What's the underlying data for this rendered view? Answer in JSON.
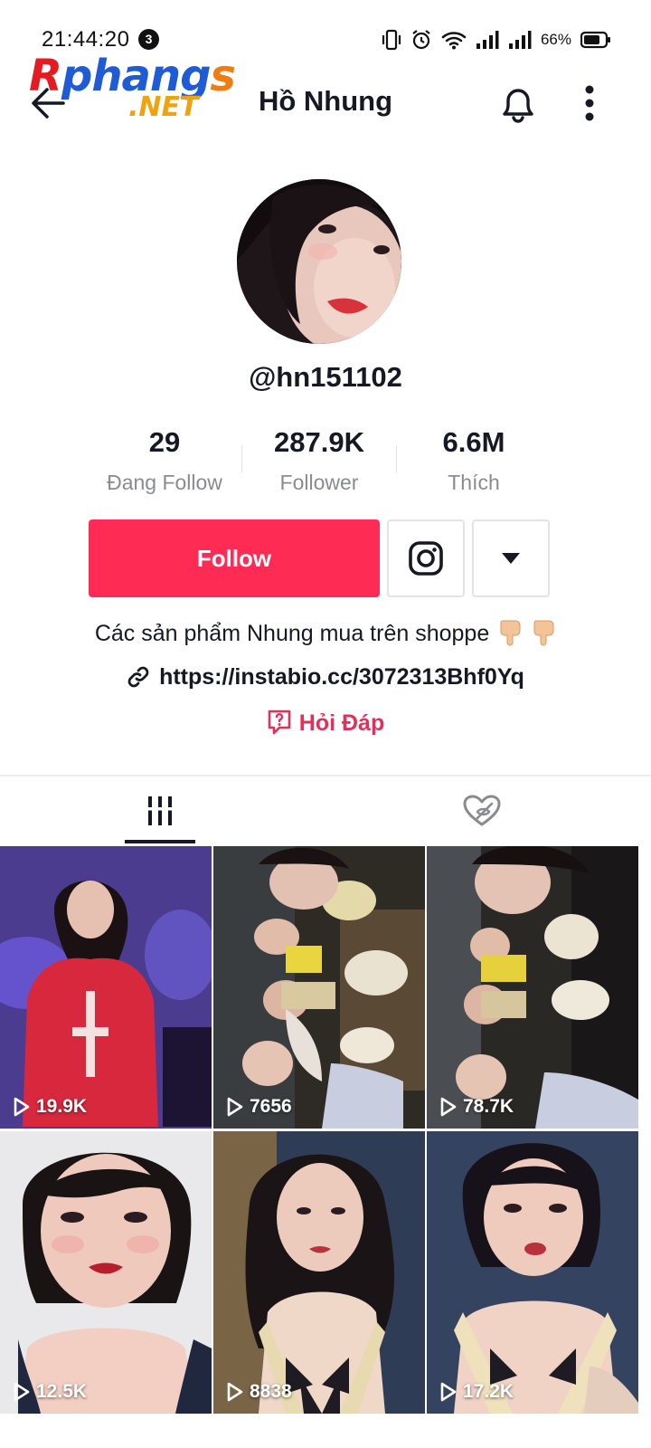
{
  "status_bar": {
    "time": "21:44:20",
    "notification_count": "3",
    "battery": "66%"
  },
  "watermark": {
    "top": "Rphangs",
    "bottom": ".NET"
  },
  "header": {
    "title": "Hồ Nhung"
  },
  "profile": {
    "username": "@hn151102",
    "stats": [
      {
        "value": "29",
        "label": "Đang Follow"
      },
      {
        "value": "287.9K",
        "label": "Follower"
      },
      {
        "value": "6.6M",
        "label": "Thích"
      }
    ],
    "follow_label": "Follow",
    "bio": "Các sản phẩm Nhung mua trên shoppe",
    "link": "https://instabio.cc/3072313Bhf0Yq",
    "qa_label": "Hỏi Đáp"
  },
  "videos": [
    {
      "views": "19.9K"
    },
    {
      "views": "7656"
    },
    {
      "views": "78.7K"
    },
    {
      "views": "12.5K"
    },
    {
      "views": "8838"
    },
    {
      "views": "17.2K"
    }
  ],
  "colors": {
    "accent": "#fe2c55",
    "qa": "#e1315a",
    "text": "#161823",
    "muted": "#8a8b91"
  }
}
